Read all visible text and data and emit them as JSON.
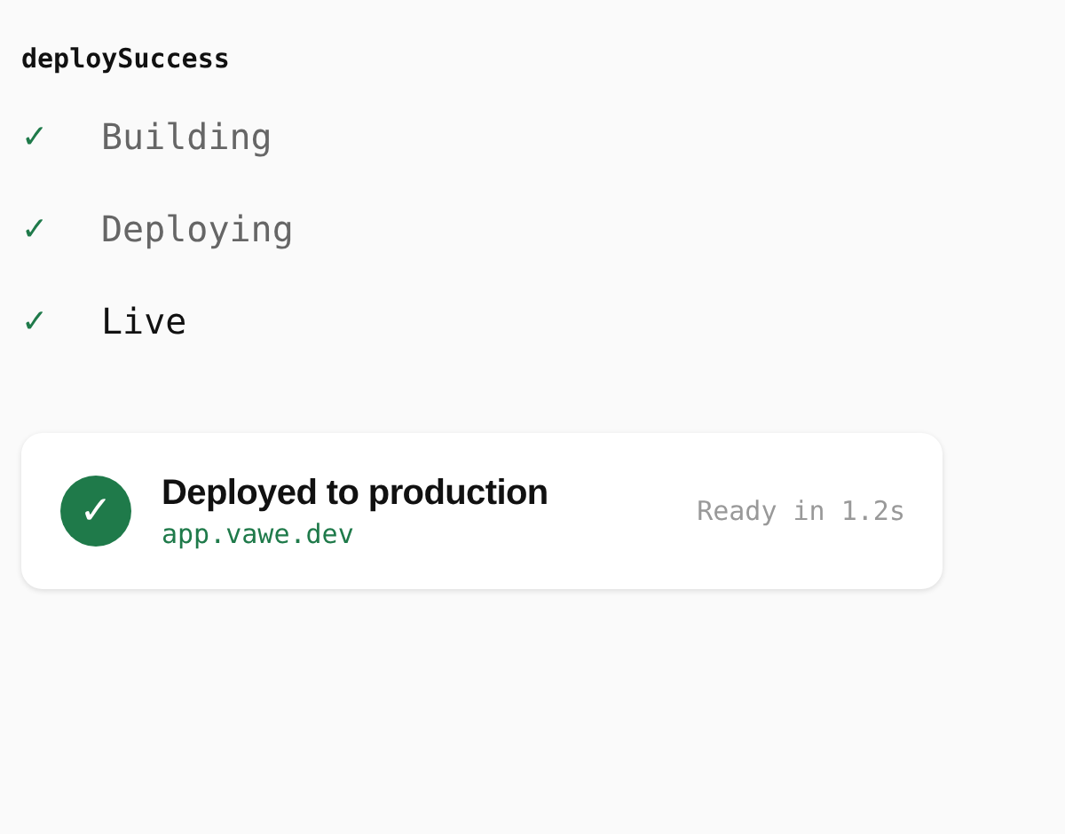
{
  "title": "deploySuccess",
  "steps": [
    {
      "check": "✓",
      "label": "Building",
      "done": true,
      "current": false
    },
    {
      "check": "✓",
      "label": "Deploying",
      "done": true,
      "current": false
    },
    {
      "check": "✓",
      "label": "Live",
      "done": true,
      "current": true
    }
  ],
  "card": {
    "status_icon": "✓",
    "title": "Deployed to production",
    "url": "app.vawe.dev",
    "timing": "Ready in 1.2s"
  }
}
